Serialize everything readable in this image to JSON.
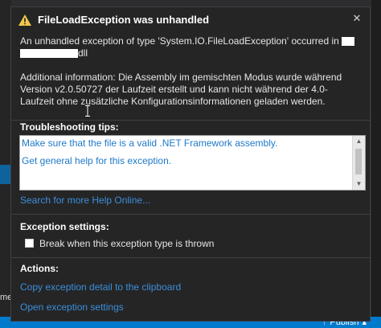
{
  "ide": {
    "left_text": "me",
    "publish_label": "Publish"
  },
  "popup": {
    "title": "FileLoadException was unhandled",
    "close_glyph": "✕",
    "message_line1": "An unhandled exception of type 'System.IO.FileLoadException' occurred in",
    "message_line2_suffix": "dll",
    "additional_info": "Additional information: Die Assembly im gemischten Modus wurde während Version v2.0.50727 der Laufzeit erstellt und kann nicht während der 4.0-Laufzeit ohne zusätzliche Konfigurationsinformationen geladen werden.",
    "troubleshooting": {
      "heading": "Troubleshooting tips:",
      "tips": [
        "Make sure that the file is a valid .NET Framework assembly.",
        "Get general help for this exception."
      ]
    },
    "search_help_link": "Search for more Help Online...",
    "exception_settings": {
      "heading": "Exception settings:",
      "break_checkbox_label": "Break when this exception type is thrown",
      "break_checked": false
    },
    "actions": {
      "heading": "Actions:",
      "copy_detail_link": "Copy exception detail to the clipboard",
      "open_settings_link": "Open exception settings"
    }
  },
  "colors": {
    "link": "#3c8fdb",
    "warning_icon": "#f2c94c",
    "popup_background": "#252526"
  },
  "icons": {
    "warning": "warning-icon",
    "close": "close-icon"
  }
}
